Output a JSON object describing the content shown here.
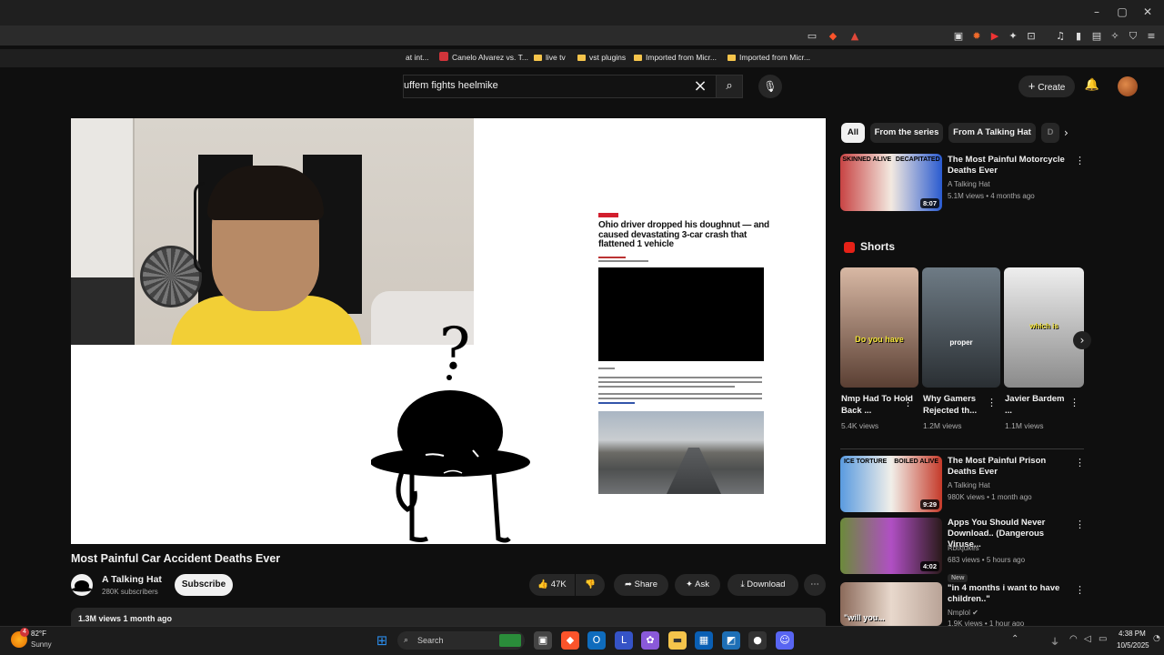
{
  "bookmarks": [
    {
      "label": "at int..."
    },
    {
      "label": "Canelo Alvarez vs. T..."
    },
    {
      "label": "live tv"
    },
    {
      "label": "vst plugins"
    },
    {
      "label": "Imported from Micr..."
    },
    {
      "label": "Imported from Micr..."
    }
  ],
  "search": {
    "value": "uffem fights heelmike"
  },
  "header": {
    "create_label": "Create"
  },
  "video": {
    "title": "Most Painful Car Accident Deaths Ever",
    "channel": "A Talking Hat",
    "subscribers": "280K subscribers",
    "subscribe_label": "Subscribe",
    "likes": "47K",
    "share_label": "Share",
    "ask_label": "Ask",
    "download_label": "Download",
    "views_date": "1.3M views  1 month ago",
    "article_title": "Ohio driver dropped his doughnut — and caused devastating 3-car crash that flattened 1 vehicle",
    "question_mark": "?"
  },
  "chips": [
    "All",
    "From the series",
    "From A Talking Hat",
    "D"
  ],
  "related": [
    {
      "title": "The Most Painful Motorcycle Deaths Ever",
      "channel": "A Talking Hat",
      "meta": "5.1M views • 4 months ago",
      "duration": "8:07",
      "thumb_text": [
        "SKINNED ALIVE",
        "DECAPITATED"
      ],
      "accent": "#d02b2b"
    },
    {
      "title": "The Most Painful Prison Deaths Ever",
      "channel": "A Talking Hat",
      "meta": "980K views • 1 month ago",
      "duration": "9:29",
      "thumb_text": [
        "ICE TORTURE",
        "BOILED ALIVE"
      ],
      "accent": "#3a7bd5"
    },
    {
      "title": "Apps You Should Never Download.. (Dangerous Viruse...",
      "channel": "Rblxjukes",
      "meta": "683 views • 5 hours ago",
      "duration": "4:02",
      "badge": "New"
    },
    {
      "title": "\"in 4 months i want to have children..\"",
      "channel": "Nmplol",
      "meta": "1.9K views • 1 hour ago",
      "thumb_text": [
        "\"will you..."
      ]
    }
  ],
  "shorts": {
    "heading": "Shorts",
    "items": [
      {
        "title": "Nmp Had To Hold Back ...",
        "views": "5.4K views",
        "overlay": "Do you have"
      },
      {
        "title": "Why Gamers Rejected th...",
        "views": "1.2M views",
        "overlay": "proper"
      },
      {
        "title": "Javier Bardem ...",
        "views": "1.1M views",
        "overlay": "which is"
      }
    ]
  },
  "taskbar": {
    "search_placeholder": "Search",
    "weather_temp": "82°F",
    "weather_desc": "Sunny",
    "weather_badge": "4",
    "time": "4:38 PM",
    "date": "10/5/2025"
  }
}
